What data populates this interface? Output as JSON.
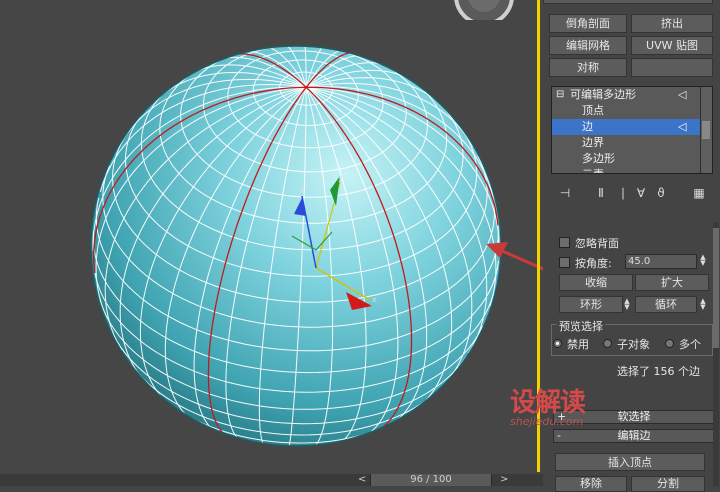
{
  "panel": {
    "buttons": {
      "bevel_profile": "倒角剖面",
      "extrude": "挤出",
      "edit_mesh": "编辑网格",
      "uvw_map": "UVW 贴图",
      "symmetry": "对称"
    },
    "stack": {
      "items": [
        {
          "label": "可编辑多边形",
          "expander": "⊟"
        },
        {
          "label": "顶点"
        },
        {
          "label": "边"
        },
        {
          "label": "边界"
        },
        {
          "label": "多边形"
        },
        {
          "label": "元素"
        }
      ]
    },
    "selection": {
      "ignore_backfacing": "忽略背面",
      "by_angle": "按角度:",
      "angle_value": "45.0",
      "shrink": "收缩",
      "grow": "扩大",
      "ring": "环形",
      "loop": "循环",
      "preview_group": "预览选择",
      "disabled": "禁用",
      "subobject": "子对象",
      "multiple": "多个",
      "status": "选择了 156 个边"
    },
    "soft_selection": {
      "label": "软选择",
      "toggle": "+"
    },
    "edit_edges": {
      "label": "编辑边",
      "toggle": "-",
      "insert_vertex": "插入顶点",
      "remove": "移除",
      "split": "分割"
    }
  },
  "timeline": {
    "frame": "96 / 100",
    "prev": "<",
    "next": ">"
  },
  "watermark": {
    "brand": "设解读",
    "url": "shejiedu.com"
  },
  "gizmo": {
    "x": "x",
    "y": "y",
    "z": "z"
  },
  "colors": {
    "selection_blue": "#3b74c9",
    "sphere": "#6cc7d4",
    "viewport_border": "#f2d300",
    "edge_red": "#c21a1a"
  }
}
